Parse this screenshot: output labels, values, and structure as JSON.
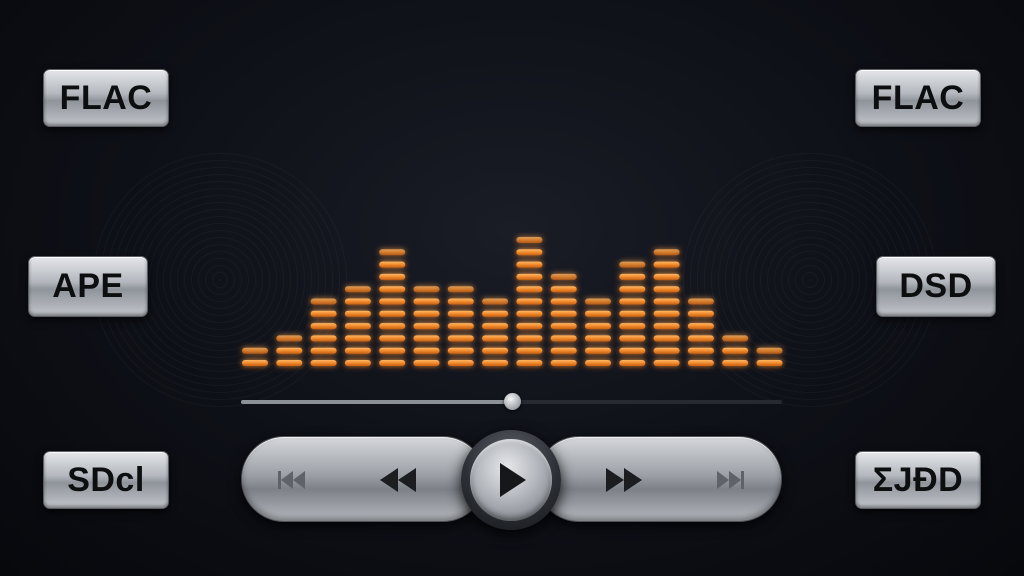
{
  "format_badges": {
    "top_left": "FLAC",
    "top_right": "FLAC",
    "middle_left": "APE",
    "middle_right": "DSD",
    "bottom_left": "SDcl",
    "bottom_right": "ƩJÐD"
  },
  "equalizer": {
    "accent_color": "#f08a2c",
    "bar_levels": [
      2,
      3,
      6,
      7,
      10,
      7,
      7,
      6,
      11,
      8,
      6,
      9,
      10,
      6,
      3,
      2
    ]
  },
  "playback": {
    "progress_fraction": 0.5,
    "state": "paused"
  },
  "transport": {
    "icons": [
      "skip-previous-icon",
      "rewind-icon",
      "play-icon",
      "fast-forward-icon",
      "skip-next-icon"
    ]
  }
}
